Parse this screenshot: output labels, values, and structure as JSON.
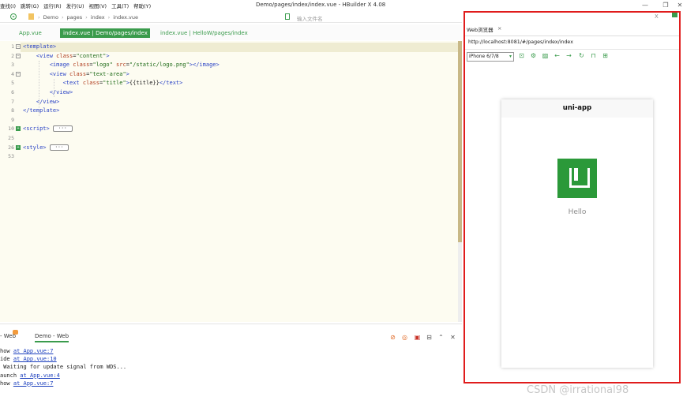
{
  "menu": {
    "items": [
      "查找(I)",
      "跳转(G)",
      "运行(R)",
      "发行(U)",
      "视图(V)",
      "工具(T)",
      "帮助(Y)"
    ]
  },
  "window": {
    "title": "Demo/pages/index/index.vue - HBuilder X 4.08",
    "controls": [
      "—",
      "❐",
      "✕"
    ]
  },
  "toolbar": {
    "breadcrumb": [
      "Demo",
      "pages",
      "index",
      "index.vue"
    ],
    "file_search_placeholder": "输入文件名"
  },
  "editor_tabs": [
    {
      "label": "App.vue",
      "active": false
    },
    {
      "label": "index.vue | Demo/pages/index",
      "active": true
    },
    {
      "label": "index.vue | HelloW/pages/index",
      "active": false
    }
  ],
  "editor": {
    "line_numbers": [
      "1",
      "2",
      "3",
      "4",
      "5",
      "6",
      "7",
      "8",
      "9",
      "10",
      "25",
      "26",
      "53"
    ],
    "lines": [
      [
        {
          "t": "<template>",
          "c": "tag"
        }
      ],
      [
        {
          "t": "    "
        },
        {
          "t": "<view ",
          "c": "tag"
        },
        {
          "t": "class",
          "c": "attr"
        },
        {
          "t": "=",
          "c": "txt"
        },
        {
          "t": "\"content\"",
          "c": "str"
        },
        {
          "t": ">",
          "c": "tag"
        }
      ],
      [
        {
          "t": "        "
        },
        {
          "t": "<image ",
          "c": "tag"
        },
        {
          "t": "class",
          "c": "attr"
        },
        {
          "t": "=",
          "c": "txt"
        },
        {
          "t": "\"logo\"",
          "c": "str"
        },
        {
          "t": " "
        },
        {
          "t": "src",
          "c": "attr"
        },
        {
          "t": "=",
          "c": "txt"
        },
        {
          "t": "\"/static/logo.png\"",
          "c": "str"
        },
        {
          "t": "></image>",
          "c": "tag"
        }
      ],
      [
        {
          "t": "        "
        },
        {
          "t": "<view ",
          "c": "tag"
        },
        {
          "t": "class",
          "c": "attr"
        },
        {
          "t": "=",
          "c": "txt"
        },
        {
          "t": "\"text-area\"",
          "c": "str"
        },
        {
          "t": ">",
          "c": "tag"
        }
      ],
      [
        {
          "t": "            "
        },
        {
          "t": "<text ",
          "c": "tag"
        },
        {
          "t": "class",
          "c": "attr"
        },
        {
          "t": "=",
          "c": "txt"
        },
        {
          "t": "\"title\"",
          "c": "str"
        },
        {
          "t": ">",
          "c": "tag"
        },
        {
          "t": "{{title}}",
          "c": "txt"
        },
        {
          "t": "</text>",
          "c": "tag"
        }
      ],
      [
        {
          "t": "        "
        },
        {
          "t": "</view>",
          "c": "tag"
        }
      ],
      [
        {
          "t": "    "
        },
        {
          "t": "</view>",
          "c": "tag"
        }
      ],
      [
        {
          "t": "</template>",
          "c": "tag"
        }
      ],
      [],
      [
        {
          "t": "<script>",
          "c": "tag"
        }
      ],
      [],
      [
        {
          "t": "<style>",
          "c": "tag"
        }
      ],
      []
    ],
    "collapsed_label": "···"
  },
  "console": {
    "tabs": [
      {
        "label": "- Web",
        "active": false
      },
      {
        "label": "Demo - Web",
        "active": true
      }
    ],
    "lines": [
      {
        "prefix": "how ",
        "link": "at App.vue:7"
      },
      {
        "prefix": "ide ",
        "link": "at App.vue:10"
      },
      {
        "prefix": " Waiting for update signal from WDS...",
        "link": ""
      },
      {
        "prefix": "aunch ",
        "link": "at App.vue:4"
      },
      {
        "prefix": "how ",
        "link": "at App.vue:7"
      }
    ]
  },
  "browser": {
    "tab_label": "Web浏览器",
    "tab_close": "×",
    "url": "http://localhost:8081/#/pages/index/index",
    "device": "iPhone 6/7/8",
    "panel_close": "X",
    "phone": {
      "nav_title": "uni-app",
      "text": "Hello"
    }
  },
  "watermark": "CSDN @irrational98",
  "colors": {
    "accent_green": "#3a9b4c",
    "logo_green": "#2b9939",
    "highlight_border": "#e01c1c",
    "editor_bg": "#fdfcf1"
  }
}
